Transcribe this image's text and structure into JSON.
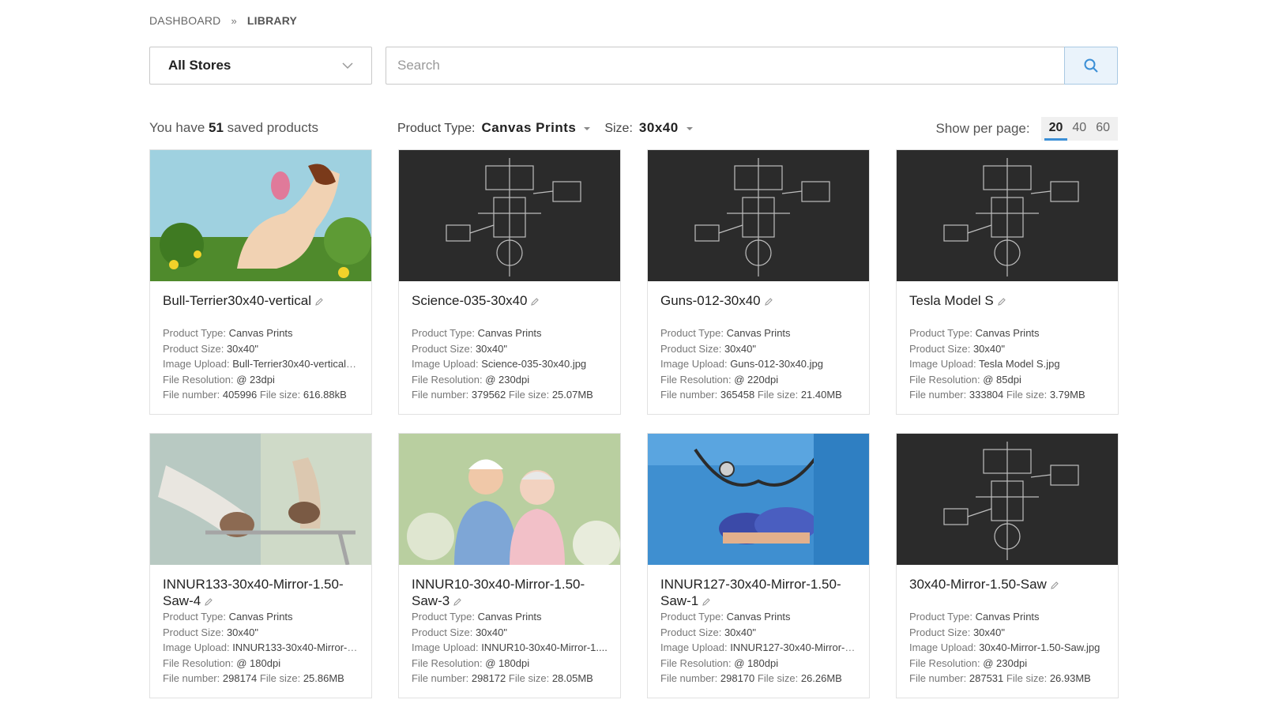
{
  "breadcrumb": {
    "root": "DASHBOARD",
    "separator": "»",
    "current": "LIBRARY"
  },
  "store_select": {
    "value": "All Stores"
  },
  "search": {
    "placeholder": "Search",
    "value": ""
  },
  "summary": {
    "prefix": "You have",
    "count": "51",
    "suffix": "saved products"
  },
  "filters": {
    "product_type_label": "Product Type:",
    "product_type_value": "Canvas Prints",
    "size_label": "Size:",
    "size_value": "30x40"
  },
  "per_page": {
    "label": "Show per page:",
    "options": [
      "20",
      "40",
      "60"
    ],
    "selected": "20"
  },
  "meta_labels": {
    "type": "Product Type:",
    "size": "Product Size:",
    "upload": "Image Upload:",
    "resolution": "File Resolution:",
    "number": "File number:",
    "filesize": "File size:"
  },
  "products": [
    {
      "title": "Bull-Terrier30x40-vertical",
      "type": "Canvas Prints",
      "size": "30x40\"",
      "upload": "Bull-Terrier30x40-vertical.j...",
      "resolution": "@ 23dpi",
      "number": "405996",
      "filesize": "616.88kB",
      "thumb": "dog"
    },
    {
      "title": "Science-035-30x40",
      "type": "Canvas Prints",
      "size": "30x40\"",
      "upload": "Science-035-30x40.jpg",
      "resolution": "@ 230dpi",
      "number": "379562",
      "filesize": "25.07MB",
      "thumb": "blueprint"
    },
    {
      "title": "Guns-012-30x40",
      "type": "Canvas Prints",
      "size": "30x40\"",
      "upload": "Guns-012-30x40.jpg",
      "resolution": "@ 220dpi",
      "number": "365458",
      "filesize": "21.40MB",
      "thumb": "blueprint"
    },
    {
      "title": "Tesla Model S",
      "type": "Canvas Prints",
      "size": "30x40\"",
      "upload": "Tesla Model S.jpg",
      "resolution": "@ 85dpi",
      "number": "333804",
      "filesize": "3.79MB",
      "thumb": "blueprint"
    },
    {
      "title": "INNUR133-30x40-Mirror-1.50-Saw-4",
      "type": "Canvas Prints",
      "size": "30x40\"",
      "upload": "INNUR133-30x40-Mirror-1...",
      "resolution": "@ 180dpi",
      "number": "298174",
      "filesize": "25.86MB",
      "thumb": "walker"
    },
    {
      "title": "INNUR10-30x40-Mirror-1.50-Saw-3",
      "type": "Canvas Prints",
      "size": "30x40\"",
      "upload": "INNUR10-30x40-Mirror-1....",
      "resolution": "@ 180dpi",
      "number": "298172",
      "filesize": "28.05MB",
      "thumb": "nurse"
    },
    {
      "title": "INNUR127-30x40-Mirror-1.50-Saw-1",
      "type": "Canvas Prints",
      "size": "30x40\"",
      "upload": "INNUR127-30x40-Mirror-1...",
      "resolution": "@ 180dpi",
      "number": "298170",
      "filesize": "26.26MB",
      "thumb": "doctor"
    },
    {
      "title": "30x40-Mirror-1.50-Saw",
      "type": "Canvas Prints",
      "size": "30x40\"",
      "upload": "30x40-Mirror-1.50-Saw.jpg",
      "resolution": "@ 230dpi",
      "number": "287531",
      "filesize": "26.93MB",
      "thumb": "blueprint"
    }
  ],
  "colors": {
    "accent": "#3b8fd6",
    "search_btn_bg": "#eaf3fb",
    "blueprint_bg": "#2a2a2a"
  },
  "icons": {
    "search": "search-icon",
    "dropdown": "chevron-down-icon",
    "edit": "pencil-icon"
  }
}
